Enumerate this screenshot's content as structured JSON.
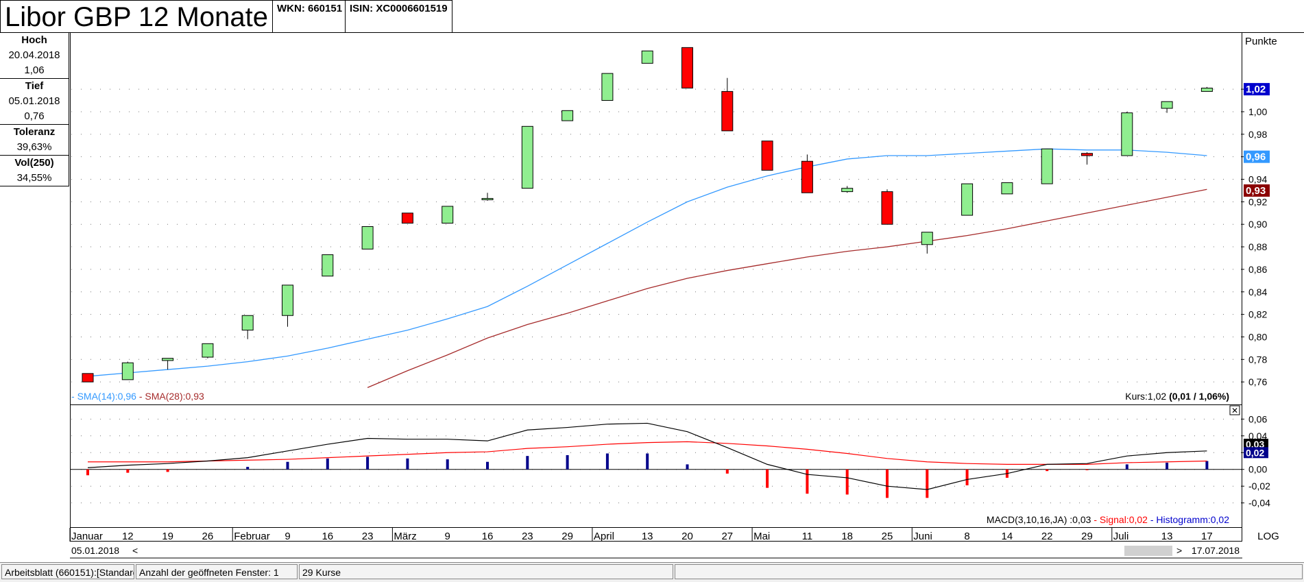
{
  "header": {
    "title": "Libor GBP 12 Monate",
    "wkn": "WKN: 660151",
    "isin": "ISIN: XC0006601519"
  },
  "sidebar": {
    "hoch": {
      "label": "Hoch",
      "date": "20.04.2018",
      "value": "1,06"
    },
    "tief": {
      "label": "Tief",
      "date": "05.01.2018",
      "value": "0,76"
    },
    "toleranz": {
      "label": "Toleranz",
      "value": "39,63%"
    },
    "vol": {
      "label": "Vol(250)",
      "value": "34,55%"
    }
  },
  "main": {
    "unit_label": "Punkte",
    "sma_legend": {
      "sma14": "SMA(14):0,96",
      "sma28": "SMA(28):0,93"
    },
    "kurs_text": "Kurs:1,02",
    "kurs_change": "(0,01 / 1,06%)",
    "macd_legend": {
      "macd": "MACD(3,10,16,JA) :0,03",
      "signal": "Signal:0,02",
      "histogram": "Histogramm:0,02"
    },
    "log_label": "LOG",
    "start_date": "05.01.2018",
    "end_date": "17.07.2018",
    "close_glyph": "✕"
  },
  "statusbar": {
    "sheet": "Arbeitsblatt (660151):[Standard]",
    "windows": "Anzahl der geöffneten Fenster: 1",
    "count": "29 Kurse"
  },
  "colors": {
    "up": "#90ee90",
    "down": "#ff0000",
    "sma14": "#3399ff",
    "sma28": "#a52a2a",
    "macd": "#000000",
    "signal": "#ff0000",
    "hist_pos": "#00008b",
    "hist_neg": "#ff0000",
    "last_price_bg": "#0000cd",
    "sma14_bg": "#3399ff",
    "sma28_bg": "#8b0000"
  },
  "chart_data": [
    {
      "type": "candlestick",
      "title": "Libor GBP 12 Monate",
      "ylabel": "Punkte",
      "ylim": [
        0.74,
        1.07
      ],
      "yticks": [
        "0,76",
        "0,78",
        "0,80",
        "0,82",
        "0,84",
        "0,86",
        "0,88",
        "0,90",
        "0,92",
        "0,94",
        "0,96",
        "0,98",
        "1,00",
        "1,02"
      ],
      "x_labels": [
        "Januar",
        "12",
        "19",
        "26",
        "Februar",
        "9",
        "16",
        "23",
        "März",
        "9",
        "16",
        "23",
        "29",
        "April",
        "13",
        "20",
        "27",
        "Mai",
        "11",
        "18",
        "25",
        "Juni",
        "8",
        "14",
        "22",
        "29",
        "Juli",
        "13",
        "17"
      ],
      "candles": [
        {
          "o": 0.7675,
          "h": 0.7675,
          "l": 0.76,
          "c": 0.76
        },
        {
          "o": 0.762,
          "h": 0.778,
          "l": 0.762,
          "c": 0.777
        },
        {
          "o": 0.779,
          "h": 0.781,
          "l": 0.771,
          "c": 0.781
        },
        {
          "o": 0.782,
          "h": 0.794,
          "l": 0.781,
          "c": 0.794
        },
        {
          "o": 0.806,
          "h": 0.819,
          "l": 0.798,
          "c": 0.819
        },
        {
          "o": 0.819,
          "h": 0.846,
          "l": 0.809,
          "c": 0.846
        },
        {
          "o": 0.854,
          "h": 0.873,
          "l": 0.854,
          "c": 0.873
        },
        {
          "o": 0.878,
          "h": 0.898,
          "l": 0.878,
          "c": 0.898
        },
        {
          "o": 0.91,
          "h": 0.91,
          "l": 0.901,
          "c": 0.901
        },
        {
          "o": 0.901,
          "h": 0.916,
          "l": 0.901,
          "c": 0.916
        },
        {
          "o": 0.922,
          "h": 0.928,
          "l": 0.921,
          "c": 0.923
        },
        {
          "o": 0.932,
          "h": 0.987,
          "l": 0.932,
          "c": 0.987
        },
        {
          "o": 0.992,
          "h": 1.001,
          "l": 0.992,
          "c": 1.001
        },
        {
          "o": 1.01,
          "h": 1.034,
          "l": 1.01,
          "c": 1.034
        },
        {
          "o": 1.043,
          "h": 1.054,
          "l": 1.043,
          "c": 1.054
        },
        {
          "o": 1.057,
          "h": 1.057,
          "l": 1.021,
          "c": 1.021
        },
        {
          "o": 1.018,
          "h": 1.03,
          "l": 0.983,
          "c": 0.983
        },
        {
          "o": 0.974,
          "h": 0.974,
          "l": 0.948,
          "c": 0.948
        },
        {
          "o": 0.956,
          "h": 0.962,
          "l": 0.928,
          "c": 0.928
        },
        {
          "o": 0.929,
          "h": 0.934,
          "l": 0.928,
          "c": 0.932
        },
        {
          "o": 0.929,
          "h": 0.931,
          "l": 0.9,
          "c": 0.9
        },
        {
          "o": 0.882,
          "h": 0.893,
          "l": 0.874,
          "c": 0.893
        },
        {
          "o": 0.908,
          "h": 0.936,
          "l": 0.908,
          "c": 0.936
        },
        {
          "o": 0.927,
          "h": 0.937,
          "l": 0.927,
          "c": 0.937
        },
        {
          "o": 0.936,
          "h": 0.967,
          "l": 0.936,
          "c": 0.967
        },
        {
          "o": 0.963,
          "h": 0.964,
          "l": 0.953,
          "c": 0.961
        },
        {
          "o": 0.961,
          "h": 1.0,
          "l": 0.961,
          "c": 0.999
        },
        {
          "o": 1.003,
          "h": 1.009,
          "l": 0.999,
          "c": 1.009
        },
        {
          "o": 1.018,
          "h": 1.022,
          "l": 1.018,
          "c": 1.021
        }
      ],
      "series": [
        {
          "name": "SMA(14)",
          "values": [
            0.765,
            0.768,
            0.771,
            0.774,
            0.778,
            0.783,
            0.79,
            0.798,
            0.806,
            0.816,
            0.827,
            0.845,
            0.864,
            0.883,
            0.902,
            0.92,
            0.933,
            0.943,
            0.951,
            0.958,
            0.961,
            0.961,
            0.963,
            0.965,
            0.967,
            0.966,
            0.966,
            0.964,
            0.961
          ]
        },
        {
          "name": "SMA(28)",
          "values": [
            null,
            null,
            null,
            null,
            null,
            null,
            null,
            0.755,
            0.77,
            0.784,
            0.799,
            0.811,
            0.821,
            0.832,
            0.843,
            0.852,
            0.859,
            0.865,
            0.871,
            0.876,
            0.88,
            0.885,
            0.89,
            0.896,
            0.903,
            0.91,
            0.917,
            0.924,
            0.931
          ]
        }
      ],
      "price_labels": {
        "last": "1,02",
        "sma14": "0,96",
        "sma28": "0,93"
      }
    },
    {
      "type": "macd",
      "ylim": [
        -0.055,
        0.075
      ],
      "yticks": [
        "-0,04",
        "-0,02",
        "0,00",
        "0,02",
        "0,04",
        "0,06"
      ],
      "series": [
        {
          "name": "MACD",
          "values": [
            0.002,
            0.005,
            0.007,
            0.01,
            0.014,
            0.022,
            0.03,
            0.037,
            0.036,
            0.036,
            0.034,
            0.047,
            0.05,
            0.054,
            0.055,
            0.045,
            0.026,
            0.006,
            -0.006,
            -0.01,
            -0.02,
            -0.024,
            -0.012,
            -0.005,
            0.006,
            0.007,
            0.016,
            0.02,
            0.022
          ]
        },
        {
          "name": "Signal",
          "values": [
            0.009,
            0.009,
            0.009,
            0.01,
            0.011,
            0.012,
            0.014,
            0.016,
            0.018,
            0.02,
            0.021,
            0.025,
            0.027,
            0.03,
            0.032,
            0.033,
            0.031,
            0.028,
            0.024,
            0.019,
            0.013,
            0.009,
            0.007,
            0.006,
            0.006,
            0.006,
            0.008,
            0.009,
            0.01
          ]
        },
        {
          "name": "Histogramm",
          "values": [
            -0.007,
            -0.004,
            -0.003,
            0.0,
            0.003,
            0.009,
            0.013,
            0.015,
            0.013,
            0.012,
            0.009,
            0.016,
            0.017,
            0.019,
            0.019,
            0.006,
            -0.005,
            -0.022,
            -0.029,
            -0.03,
            -0.034,
            -0.034,
            -0.019,
            -0.01,
            -0.002,
            -0.001,
            0.006,
            0.008,
            0.01
          ]
        }
      ],
      "value_labels": {
        "macd": "0,03",
        "signal": "0,02"
      }
    }
  ]
}
